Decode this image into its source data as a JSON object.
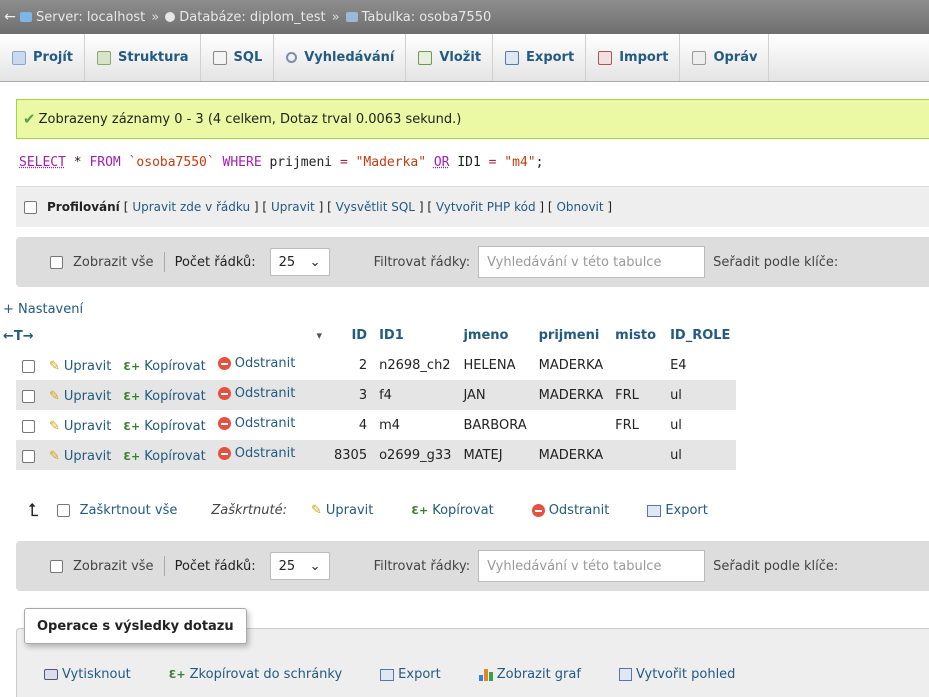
{
  "breadcrumb": {
    "back_glyph": "←",
    "items": [
      {
        "label": "Server: localhost",
        "icon": "server-icon"
      },
      {
        "label": "Databáze: diplom_test",
        "icon": "database-icon"
      },
      {
        "label": "Tabulka: osoba7550",
        "icon": "table-icon"
      }
    ],
    "separator": "»"
  },
  "tabs": [
    {
      "label": "Projít",
      "icon": "browse-icon"
    },
    {
      "label": "Struktura",
      "icon": "structure-icon"
    },
    {
      "label": "SQL",
      "icon": "sql-icon"
    },
    {
      "label": "Vyhledávání",
      "icon": "search-icon"
    },
    {
      "label": "Vložit",
      "icon": "insert-icon"
    },
    {
      "label": "Export",
      "icon": "export-icon"
    },
    {
      "label": "Import",
      "icon": "import-icon"
    },
    {
      "label": "Opráv",
      "icon": "operations-icon"
    }
  ],
  "message": {
    "text": "Zobrazeny záznamy 0 - 3 (4 celkem, Dotaz trval 0.0063 sekund.)"
  },
  "sql": {
    "select": "SELECT",
    "star": " * ",
    "from": "FROM",
    "table": " `osoba7550` ",
    "where": "WHERE",
    "cond1_col": " prijmeni ",
    "eq1": "=",
    "cond1_val": " \"Maderka\" ",
    "or": "OR",
    "cond2_col": " ID1 ",
    "eq2": "=",
    "cond2_val": " \"m4\"",
    "end": ";"
  },
  "profiling": {
    "label": "Profilování",
    "links": [
      "Upravit zde v řádku",
      "Upravit",
      "Vysvětlit SQL",
      "Vytvořit PHP kód",
      "Obnovit"
    ],
    "bracket_open": "[",
    "bracket_close": "]"
  },
  "nav": {
    "show_all": "Zobrazit vše",
    "rows_label": "Počet řádků:",
    "rows_value": "25",
    "filter_label": "Filtrovat řádky:",
    "filter_placeholder": "Vyhledávání v této tabulce",
    "sort_label": "Seřadit podle klíče:"
  },
  "settings_link": "+ Nastavení",
  "table": {
    "arrows": "←T→",
    "sort_glyph": "▾",
    "headers": [
      "ID",
      "ID1",
      "jmeno",
      "prijmeni",
      "misto",
      "ID_ROLE"
    ],
    "action_labels": {
      "edit": "Upravit",
      "copy": "Kopírovat",
      "delete": "Odstranit"
    },
    "rows": [
      {
        "ID": "2",
        "ID1": "n2698_ch2",
        "jmeno": "HELENA",
        "prijmeni": "MADERKA",
        "misto": "",
        "ID_ROLE": "E4"
      },
      {
        "ID": "3",
        "ID1": "f4",
        "jmeno": "JAN",
        "prijmeni": "MADERKA",
        "misto": "FRL",
        "ID_ROLE": "ul"
      },
      {
        "ID": "4",
        "ID1": "m4",
        "jmeno": "BARBORA",
        "prijmeni": "",
        "misto": "FRL",
        "ID_ROLE": "ul"
      },
      {
        "ID": "8305",
        "ID1": "o2699_g33",
        "jmeno": "MATEJ",
        "prijmeni": "MADERKA",
        "misto": "",
        "ID_ROLE": "ul"
      }
    ]
  },
  "bulk": {
    "check_all": "Zaškrtnout vše",
    "checked_label": "Zaškrtnuté:",
    "edit": "Upravit",
    "copy": "Kopírovat",
    "delete": "Odstranit",
    "export": "Export"
  },
  "operations": {
    "legend": "Operace s výsledky dotazu",
    "print": "Vytisknout",
    "copy_clipboard": "Zkopírovat do schránky",
    "export": "Export",
    "chart": "Zobrazit graf",
    "create_view": "Vytvořit pohled"
  }
}
